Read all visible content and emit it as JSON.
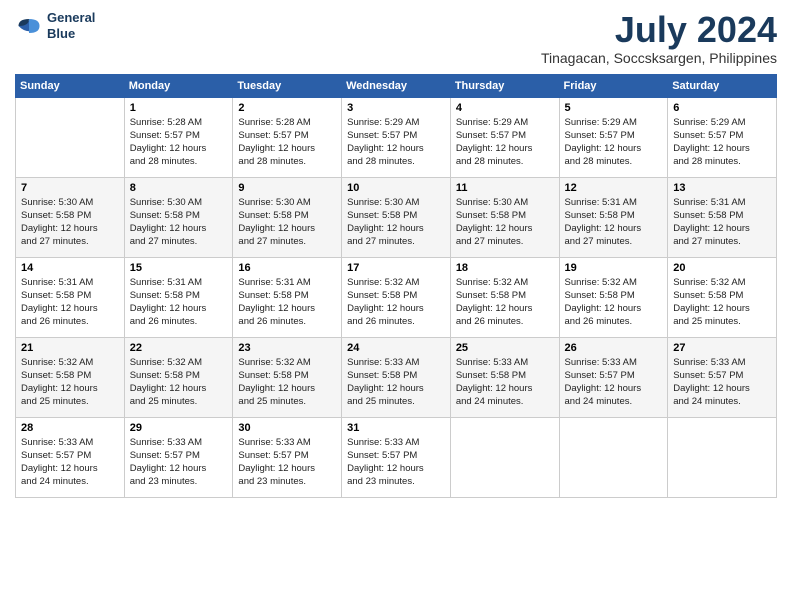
{
  "logo": {
    "line1": "General",
    "line2": "Blue"
  },
  "title": "July 2024",
  "location": "Tinagacan, Soccsksargen, Philippines",
  "days_of_week": [
    "Sunday",
    "Monday",
    "Tuesday",
    "Wednesday",
    "Thursday",
    "Friday",
    "Saturday"
  ],
  "weeks": [
    [
      {
        "day": "",
        "info": ""
      },
      {
        "day": "1",
        "info": "Sunrise: 5:28 AM\nSunset: 5:57 PM\nDaylight: 12 hours\nand 28 minutes."
      },
      {
        "day": "2",
        "info": "Sunrise: 5:28 AM\nSunset: 5:57 PM\nDaylight: 12 hours\nand 28 minutes."
      },
      {
        "day": "3",
        "info": "Sunrise: 5:29 AM\nSunset: 5:57 PM\nDaylight: 12 hours\nand 28 minutes."
      },
      {
        "day": "4",
        "info": "Sunrise: 5:29 AM\nSunset: 5:57 PM\nDaylight: 12 hours\nand 28 minutes."
      },
      {
        "day": "5",
        "info": "Sunrise: 5:29 AM\nSunset: 5:57 PM\nDaylight: 12 hours\nand 28 minutes."
      },
      {
        "day": "6",
        "info": "Sunrise: 5:29 AM\nSunset: 5:57 PM\nDaylight: 12 hours\nand 28 minutes."
      }
    ],
    [
      {
        "day": "7",
        "info": "Sunrise: 5:30 AM\nSunset: 5:58 PM\nDaylight: 12 hours\nand 27 minutes."
      },
      {
        "day": "8",
        "info": "Sunrise: 5:30 AM\nSunset: 5:58 PM\nDaylight: 12 hours\nand 27 minutes."
      },
      {
        "day": "9",
        "info": "Sunrise: 5:30 AM\nSunset: 5:58 PM\nDaylight: 12 hours\nand 27 minutes."
      },
      {
        "day": "10",
        "info": "Sunrise: 5:30 AM\nSunset: 5:58 PM\nDaylight: 12 hours\nand 27 minutes."
      },
      {
        "day": "11",
        "info": "Sunrise: 5:30 AM\nSunset: 5:58 PM\nDaylight: 12 hours\nand 27 minutes."
      },
      {
        "day": "12",
        "info": "Sunrise: 5:31 AM\nSunset: 5:58 PM\nDaylight: 12 hours\nand 27 minutes."
      },
      {
        "day": "13",
        "info": "Sunrise: 5:31 AM\nSunset: 5:58 PM\nDaylight: 12 hours\nand 27 minutes."
      }
    ],
    [
      {
        "day": "14",
        "info": "Sunrise: 5:31 AM\nSunset: 5:58 PM\nDaylight: 12 hours\nand 26 minutes."
      },
      {
        "day": "15",
        "info": "Sunrise: 5:31 AM\nSunset: 5:58 PM\nDaylight: 12 hours\nand 26 minutes."
      },
      {
        "day": "16",
        "info": "Sunrise: 5:31 AM\nSunset: 5:58 PM\nDaylight: 12 hours\nand 26 minutes."
      },
      {
        "day": "17",
        "info": "Sunrise: 5:32 AM\nSunset: 5:58 PM\nDaylight: 12 hours\nand 26 minutes."
      },
      {
        "day": "18",
        "info": "Sunrise: 5:32 AM\nSunset: 5:58 PM\nDaylight: 12 hours\nand 26 minutes."
      },
      {
        "day": "19",
        "info": "Sunrise: 5:32 AM\nSunset: 5:58 PM\nDaylight: 12 hours\nand 26 minutes."
      },
      {
        "day": "20",
        "info": "Sunrise: 5:32 AM\nSunset: 5:58 PM\nDaylight: 12 hours\nand 25 minutes."
      }
    ],
    [
      {
        "day": "21",
        "info": "Sunrise: 5:32 AM\nSunset: 5:58 PM\nDaylight: 12 hours\nand 25 minutes."
      },
      {
        "day": "22",
        "info": "Sunrise: 5:32 AM\nSunset: 5:58 PM\nDaylight: 12 hours\nand 25 minutes."
      },
      {
        "day": "23",
        "info": "Sunrise: 5:32 AM\nSunset: 5:58 PM\nDaylight: 12 hours\nand 25 minutes."
      },
      {
        "day": "24",
        "info": "Sunrise: 5:33 AM\nSunset: 5:58 PM\nDaylight: 12 hours\nand 25 minutes."
      },
      {
        "day": "25",
        "info": "Sunrise: 5:33 AM\nSunset: 5:58 PM\nDaylight: 12 hours\nand 24 minutes."
      },
      {
        "day": "26",
        "info": "Sunrise: 5:33 AM\nSunset: 5:57 PM\nDaylight: 12 hours\nand 24 minutes."
      },
      {
        "day": "27",
        "info": "Sunrise: 5:33 AM\nSunset: 5:57 PM\nDaylight: 12 hours\nand 24 minutes."
      }
    ],
    [
      {
        "day": "28",
        "info": "Sunrise: 5:33 AM\nSunset: 5:57 PM\nDaylight: 12 hours\nand 24 minutes."
      },
      {
        "day": "29",
        "info": "Sunrise: 5:33 AM\nSunset: 5:57 PM\nDaylight: 12 hours\nand 23 minutes."
      },
      {
        "day": "30",
        "info": "Sunrise: 5:33 AM\nSunset: 5:57 PM\nDaylight: 12 hours\nand 23 minutes."
      },
      {
        "day": "31",
        "info": "Sunrise: 5:33 AM\nSunset: 5:57 PM\nDaylight: 12 hours\nand 23 minutes."
      },
      {
        "day": "",
        "info": ""
      },
      {
        "day": "",
        "info": ""
      },
      {
        "day": "",
        "info": ""
      }
    ]
  ]
}
